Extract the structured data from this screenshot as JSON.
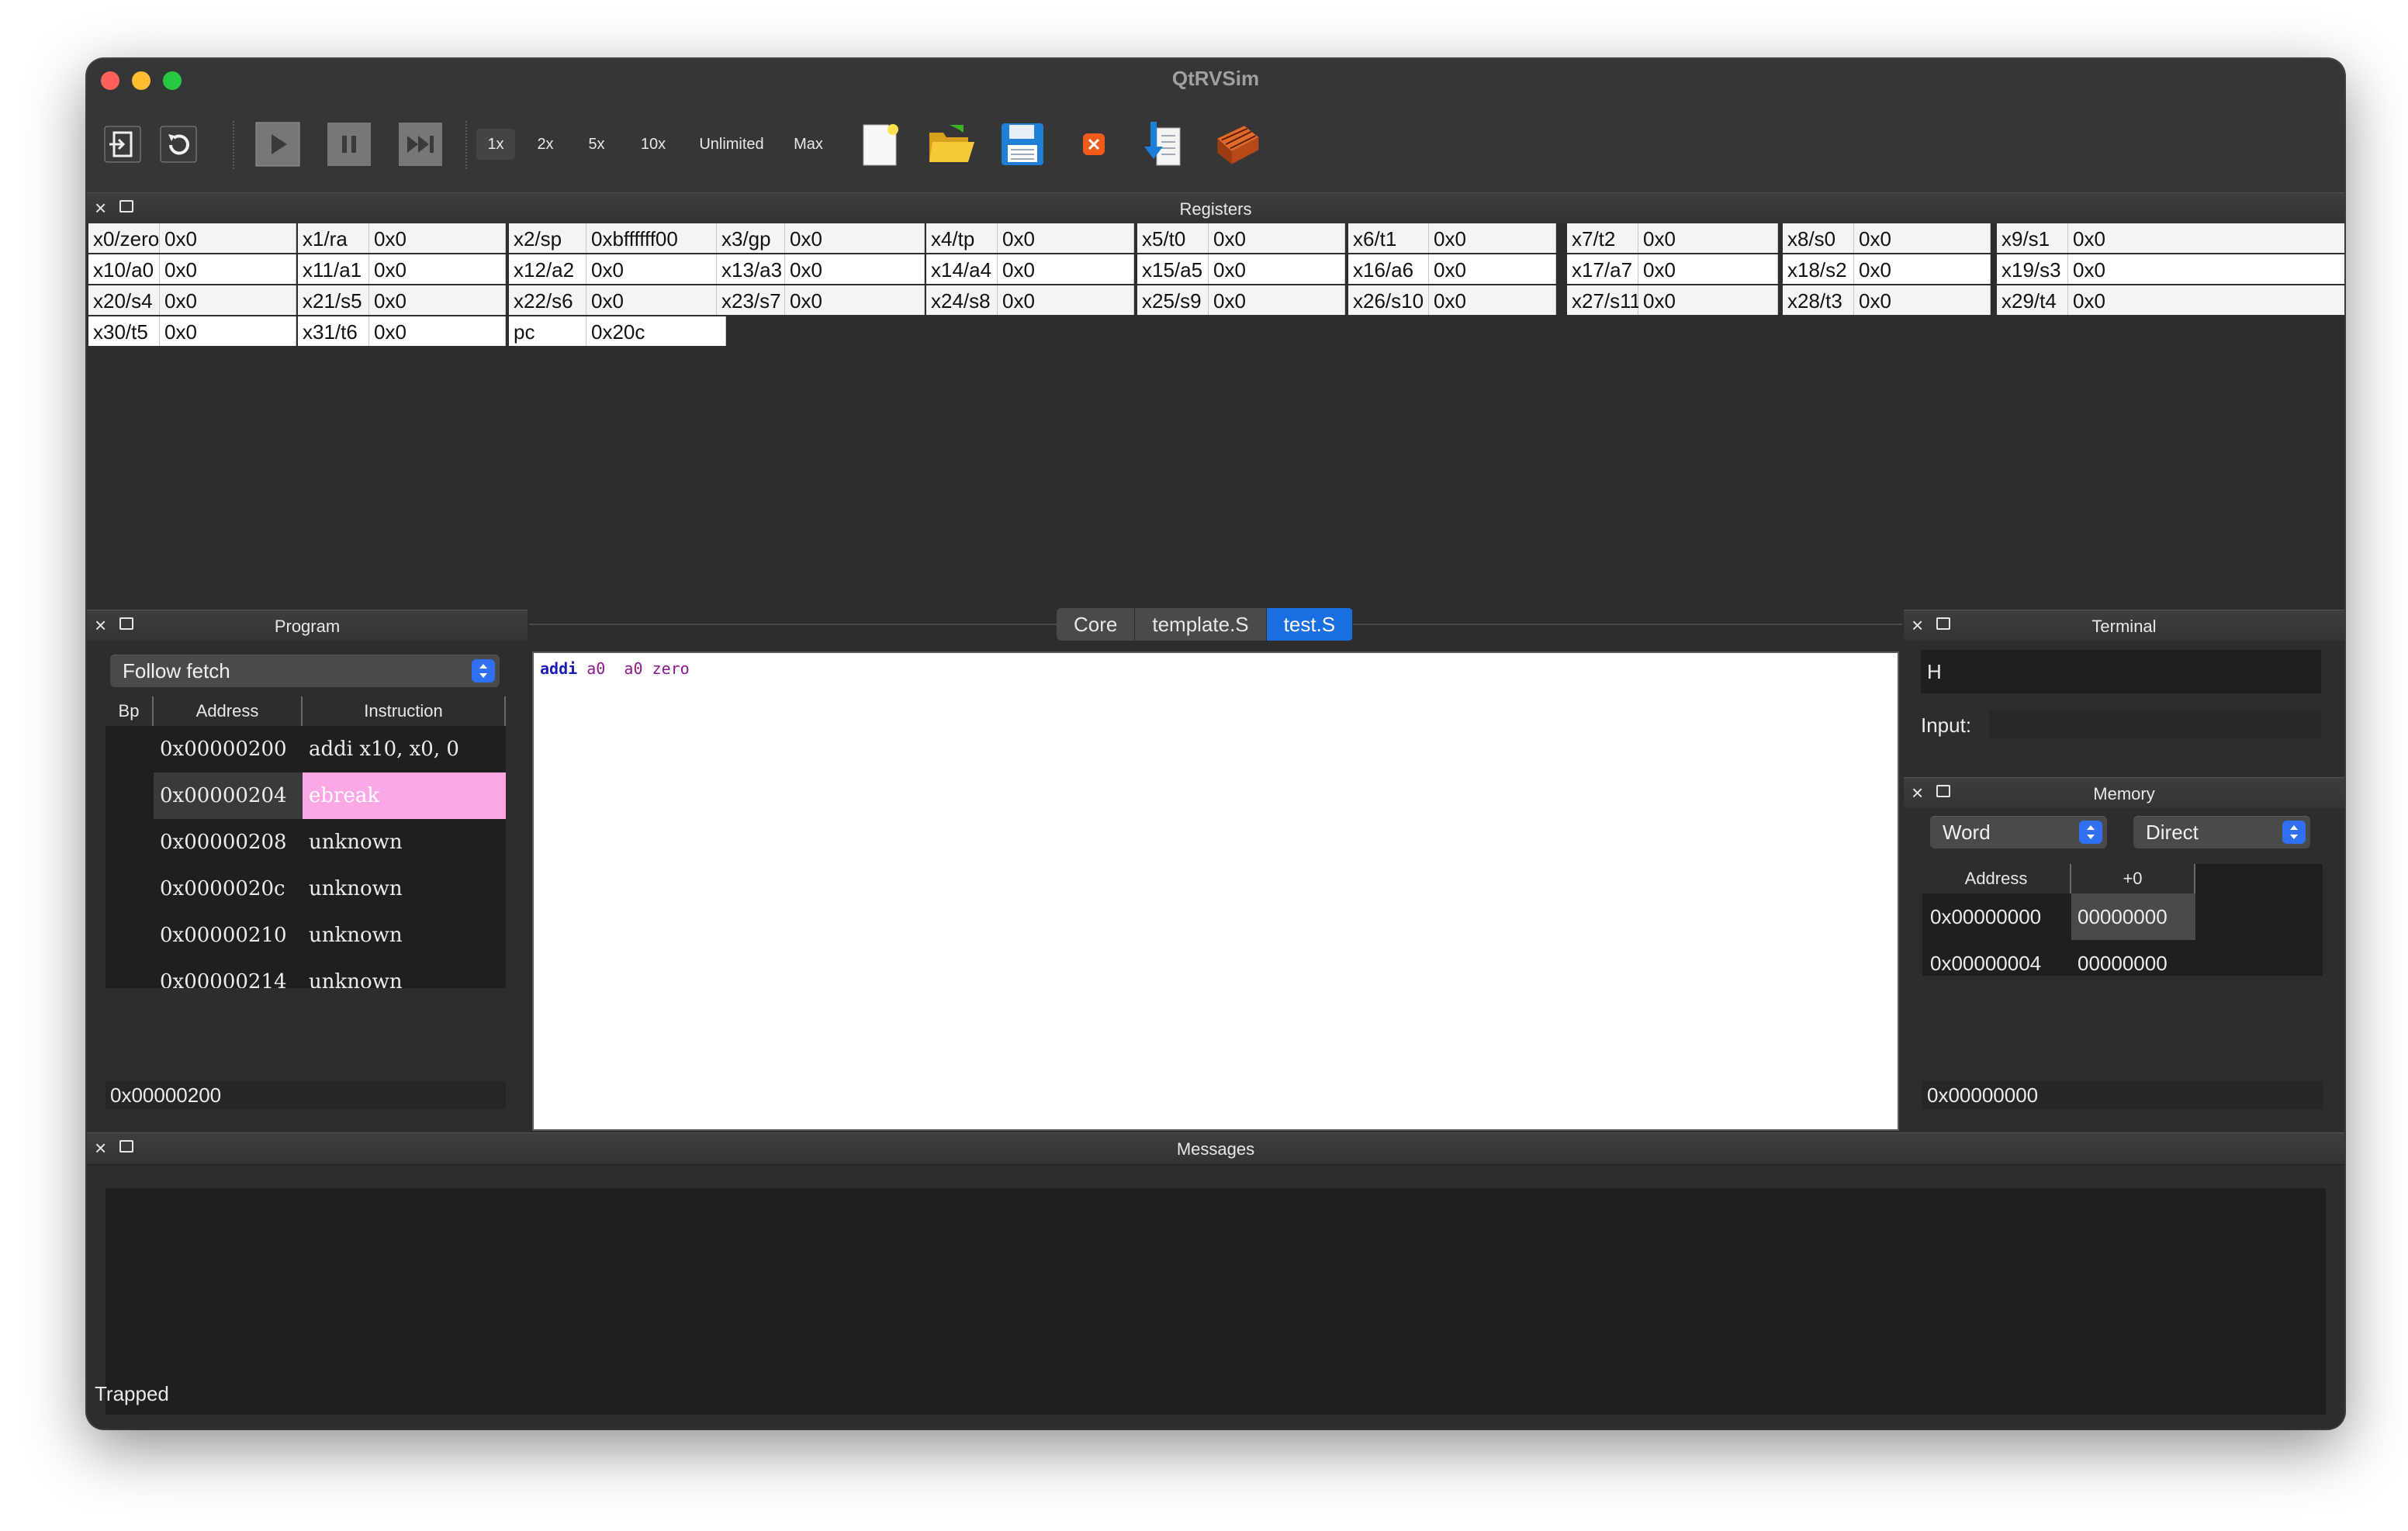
{
  "window": {
    "title": "QtRVSim"
  },
  "toolbar": {
    "icons": [
      "new-machine-icon",
      "reset-icon",
      "run-icon",
      "pause-icon",
      "step-icon",
      "new-file-icon",
      "open-file-icon",
      "save-file-icon",
      "close-file-icon",
      "compile-icon",
      "build-icon"
    ],
    "speeds": [
      "1x",
      "2x",
      "5x",
      "10x",
      "Unlimited",
      "Max"
    ],
    "selected_speed": "1x"
  },
  "registers": {
    "title": "Registers",
    "rows": [
      [
        [
          "x0/zero",
          "0x0"
        ],
        [
          "x1/ra",
          "0x0"
        ],
        [
          "x2/sp",
          "0xbffffff00"
        ],
        [
          "x3/gp",
          "0x0"
        ],
        [
          "x4/tp",
          "0x0"
        ],
        [
          "x5/t0",
          "0x0"
        ],
        [
          "x6/t1",
          "0x0"
        ],
        [
          "x7/t2",
          "0x0"
        ],
        [
          "x8/s0",
          "0x0"
        ],
        [
          "x9/s1",
          "0x0"
        ]
      ],
      [
        [
          "x10/a0",
          "0x0"
        ],
        [
          "x11/a1",
          "0x0"
        ],
        [
          "x12/a2",
          "0x0"
        ],
        [
          "x13/a3",
          "0x0"
        ],
        [
          "x14/a4",
          "0x0"
        ],
        [
          "x15/a5",
          "0x0"
        ],
        [
          "x16/a6",
          "0x0"
        ],
        [
          "x17/a7",
          "0x0"
        ],
        [
          "x18/s2",
          "0x0"
        ],
        [
          "x19/s3",
          "0x0"
        ]
      ],
      [
        [
          "x20/s4",
          "0x0"
        ],
        [
          "x21/s5",
          "0x0"
        ],
        [
          "x22/s6",
          "0x0"
        ],
        [
          "x23/s7",
          "0x0"
        ],
        [
          "x24/s8",
          "0x0"
        ],
        [
          "x25/s9",
          "0x0"
        ],
        [
          "x26/s10",
          "0x0"
        ],
        [
          "x27/s11",
          "0x0"
        ],
        [
          "x28/t3",
          "0x0"
        ],
        [
          "x29/t4",
          "0x0"
        ]
      ],
      [
        [
          "x30/t5",
          "0x0"
        ],
        [
          "x31/t6",
          "0x0"
        ],
        [
          "pc",
          "0x20c"
        ]
      ]
    ]
  },
  "program": {
    "title": "Program",
    "follow": "Follow fetch",
    "columns": [
      "Bp",
      "Address",
      "Instruction"
    ],
    "rows": [
      {
        "address": "0x00000200",
        "instruction": "addi x10, x0, 0"
      },
      {
        "address": "0x00000204",
        "instruction": "ebreak"
      },
      {
        "address": "0x00000208",
        "instruction": "unknown"
      },
      {
        "address": "0x0000020c",
        "instruction": "unknown"
      },
      {
        "address": "0x00000210",
        "instruction": "unknown"
      },
      {
        "address": "0x00000214",
        "instruction": "unknown"
      }
    ],
    "goto": "0x00000200"
  },
  "editor": {
    "tabs": [
      "Core",
      "template.S",
      "test.S"
    ],
    "active_tab": "test.S",
    "code": {
      "op": "addi",
      "r1": "a0",
      "r2": "a0",
      "r3": "zero"
    }
  },
  "terminal": {
    "title": "Terminal",
    "output": "H",
    "input_label": "Input:",
    "input_value": ""
  },
  "memory": {
    "title": "Memory",
    "unit": "Word",
    "access": "Direct",
    "columns": [
      "Address",
      "+0"
    ],
    "rows": [
      {
        "address": "0x00000000",
        "value": "00000000"
      },
      {
        "address": "0x00000004",
        "value": "00000000"
      }
    ],
    "goto": "0x00000000"
  },
  "messages": {
    "title": "Messages"
  },
  "status": "Trapped",
  "colors": {
    "accent": "#1a6fe0",
    "breakpoint_row": "#f9a8e4",
    "register_bg": "#f4f4f4"
  }
}
